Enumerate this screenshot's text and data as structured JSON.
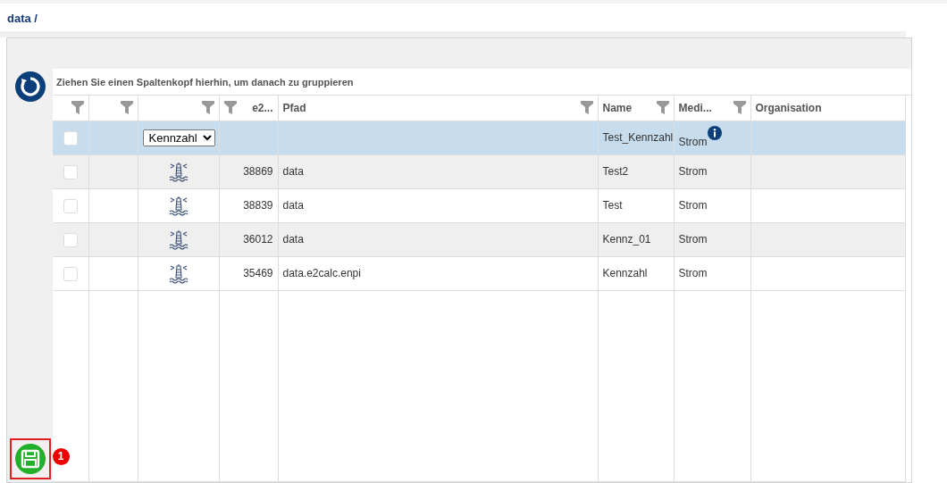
{
  "breadcrumb": "data /",
  "group_hint": "Ziehen Sie einen Spaltenkopf hierhin, um danach zu gruppieren",
  "columns": [
    {
      "filter": true
    },
    {
      "filter": true
    },
    {
      "filter": true
    },
    {
      "label": "e2...",
      "filter": true
    },
    {
      "label": "Pfad",
      "filter": true
    },
    {
      "label": "Name",
      "filter": true
    },
    {
      "label": "Medi...",
      "filter": true
    },
    {
      "label": "Organisation",
      "filter": false
    }
  ],
  "filter_row": {
    "checked": false,
    "type_value": "Kennzahl",
    "name": "Test_Kennzahl",
    "medium": "Strom",
    "info": true,
    "selected": true
  },
  "rows": [
    {
      "checked": false,
      "id": "38869",
      "path": "data",
      "name": "Test2",
      "medium": "Strom"
    },
    {
      "checked": false,
      "id": "38839",
      "path": "data",
      "name": "Test",
      "medium": "Strom"
    },
    {
      "checked": false,
      "id": "36012",
      "path": "data",
      "name": "Kennz_01",
      "medium": "Strom"
    },
    {
      "checked": false,
      "id": "35469",
      "path": "data.e2calc.enpi",
      "name": "Kennzahl",
      "medium": "Strom"
    }
  ],
  "save_button": {
    "badge": "1",
    "highlighted": true
  }
}
